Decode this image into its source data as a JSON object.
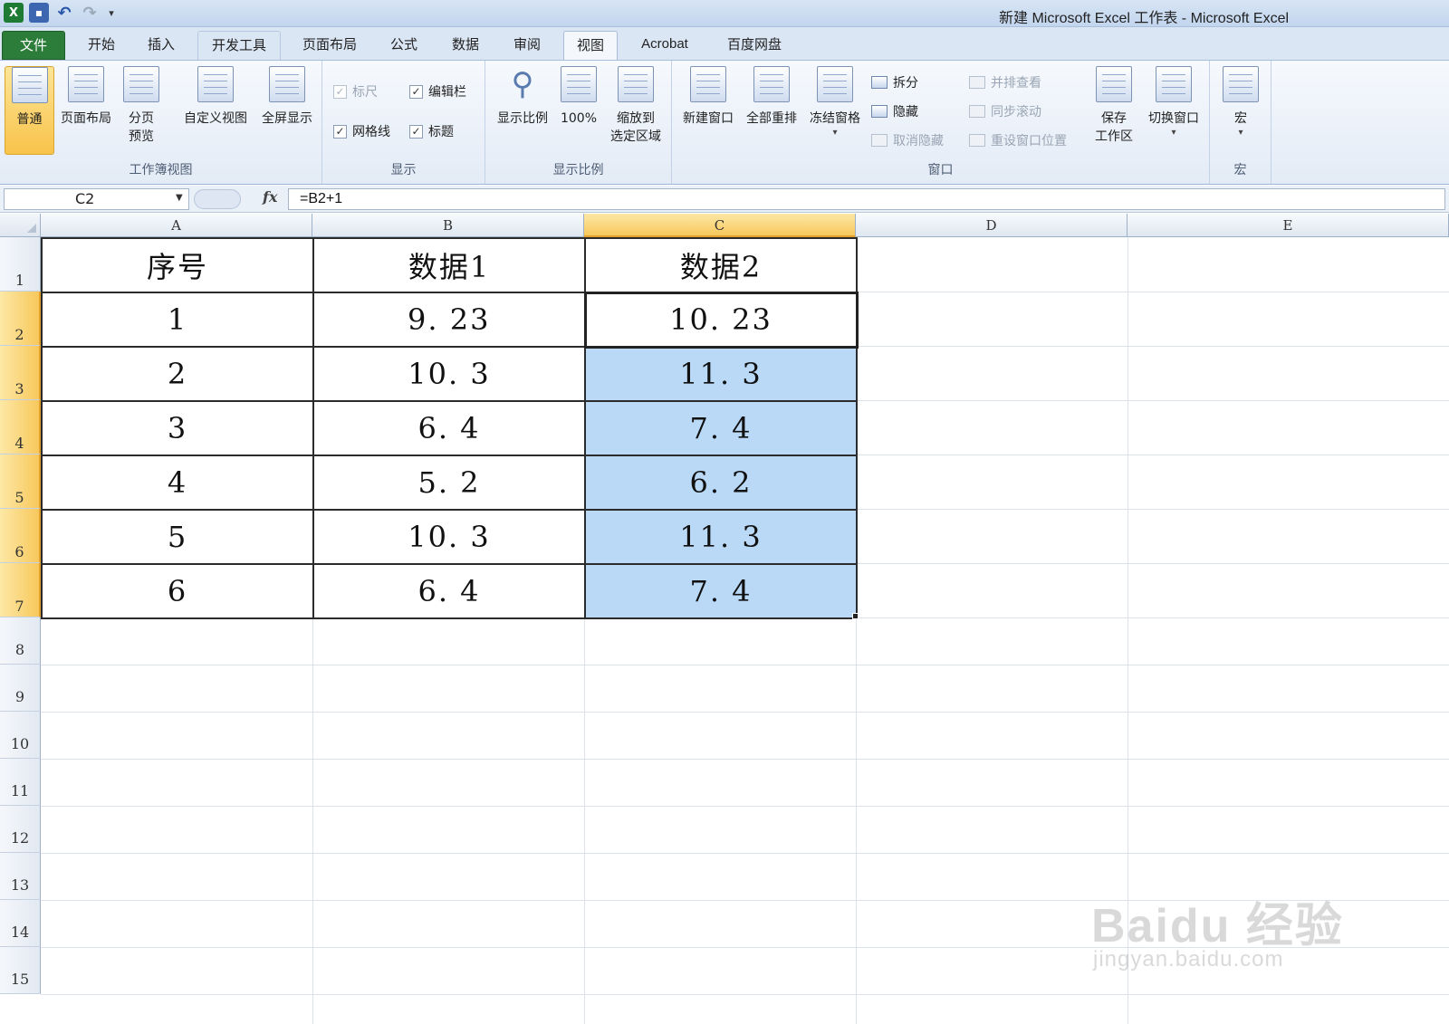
{
  "window_title": "新建 Microsoft Excel 工作表 - Microsoft Excel",
  "tabs": {
    "file": "文件",
    "home": "开始",
    "insert": "插入",
    "developer": "开发工具",
    "page_layout": "页面布局",
    "formulas": "公式",
    "data": "数据",
    "review": "审阅",
    "view": "视图",
    "acrobat": "Acrobat",
    "baidu_netdisk": "百度网盘"
  },
  "ribbon": {
    "workbook_views": {
      "label": "工作簿视图",
      "normal": "普通",
      "page_layout": "页面布局",
      "page_break_1": "分页",
      "page_break_2": "预览",
      "custom_views": "自定义视图",
      "full_screen": "全屏显示"
    },
    "show": {
      "label": "显示",
      "ruler": "标尺",
      "formula_bar": "编辑栏",
      "gridlines": "网格线",
      "headings": "标题"
    },
    "zoom": {
      "label": "显示比例",
      "zoom": "显示比例",
      "hundred": "100%",
      "zoom_sel_1": "缩放到",
      "zoom_sel_2": "选定区域"
    },
    "window": {
      "label": "窗口",
      "new_window": "新建窗口",
      "arrange_all": "全部重排",
      "freeze_panes": "冻结窗格",
      "split": "拆分",
      "hide": "隐藏",
      "unhide": "取消隐藏",
      "side_by_side": "并排查看",
      "sync_scroll": "同步滚动",
      "reset_pos": "重设窗口位置",
      "save_ws_1": "保存",
      "save_ws_2": "工作区",
      "switch_windows": "切换窗口"
    },
    "macros": {
      "label": "宏",
      "macros": "宏"
    }
  },
  "formula_bar": {
    "name_box": "C2",
    "formula": "=B2+1"
  },
  "columns": [
    "A",
    "B",
    "C",
    "D",
    "E"
  ],
  "rows": [
    "1",
    "2",
    "3",
    "4",
    "5",
    "6",
    "7",
    "8",
    "9",
    "10",
    "11",
    "12",
    "13",
    "14",
    "15"
  ],
  "table": {
    "header": [
      "序号",
      "数据1",
      "数据2"
    ],
    "rows": [
      [
        "1",
        "9. 23",
        "10. 23"
      ],
      [
        "2",
        "10. 3",
        "11. 3"
      ],
      [
        "3",
        "6. 4",
        "7. 4"
      ],
      [
        "4",
        "5. 2",
        "6. 2"
      ],
      [
        "5",
        "10. 3",
        "11. 3"
      ],
      [
        "6",
        "6. 4",
        "7. 4"
      ]
    ]
  },
  "watermark": {
    "brand": "Baidu 经验",
    "url": "jingyan.baidu.com"
  }
}
